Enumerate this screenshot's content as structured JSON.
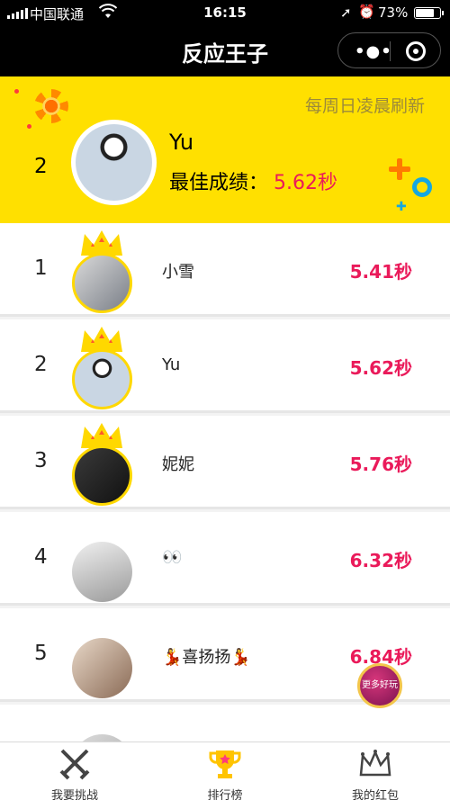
{
  "status_bar": {
    "carrier": "中国联通",
    "time": "16:15",
    "battery": "73%"
  },
  "nav": {
    "title": "反应王子",
    "more_icon": "more-dots-icon",
    "close_icon": "target-close-icon"
  },
  "my_rank": {
    "refresh_note": "每周日凌晨刷新",
    "rank": "2",
    "name": "Yu",
    "best_label": "最佳成绩：",
    "best_value": "5.62秒"
  },
  "leaderboard": [
    {
      "rank": "1",
      "name": "小雪",
      "time": "5.41秒",
      "crown": true
    },
    {
      "rank": "2",
      "name": "Yu",
      "time": "5.62秒",
      "crown": true
    },
    {
      "rank": "3",
      "name": "妮妮",
      "time": "5.76秒",
      "crown": true
    },
    {
      "rank": "4",
      "name": "👀",
      "time": "6.32秒",
      "crown": false
    },
    {
      "rank": "5",
      "name": "💃喜扬扬💃",
      "time": "6.84秒",
      "crown": false
    }
  ],
  "float_button": {
    "label": "更多好玩"
  },
  "tabbar": [
    {
      "label": "我要挑战",
      "icon": "swords-icon"
    },
    {
      "label": "排行榜",
      "icon": "trophy-icon"
    },
    {
      "label": "我的红包",
      "icon": "crown-outline-icon"
    }
  ],
  "colors": {
    "accent_yellow": "#ffe000",
    "time_pink": "#ea1a5a",
    "crown_gold": "#ffd800"
  }
}
